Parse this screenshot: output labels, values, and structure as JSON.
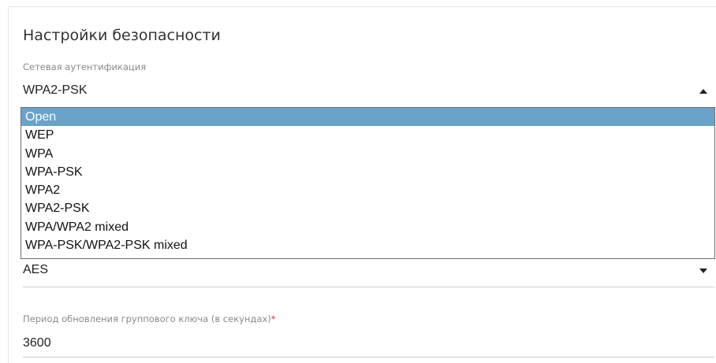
{
  "security": {
    "title": "Настройки безопасности",
    "auth": {
      "label": "Сетевая аутентификация",
      "value": "WPA2-PSK",
      "options": [
        "Open",
        "WEP",
        "WPA",
        "WPA-PSK",
        "WPA2",
        "WPA2-PSK",
        "WPA/WPA2 mixed",
        "WPA-PSK/WPA2-PSK mixed"
      ],
      "highlighted": "Open"
    },
    "encryption": {
      "value": "AES"
    },
    "rekey": {
      "label": "Период обновления группового ключа (в секундах)",
      "required_mark": "*",
      "value": "3600"
    }
  },
  "colors": {
    "highlight": "#6aa2c9",
    "required": "#e0312c"
  }
}
